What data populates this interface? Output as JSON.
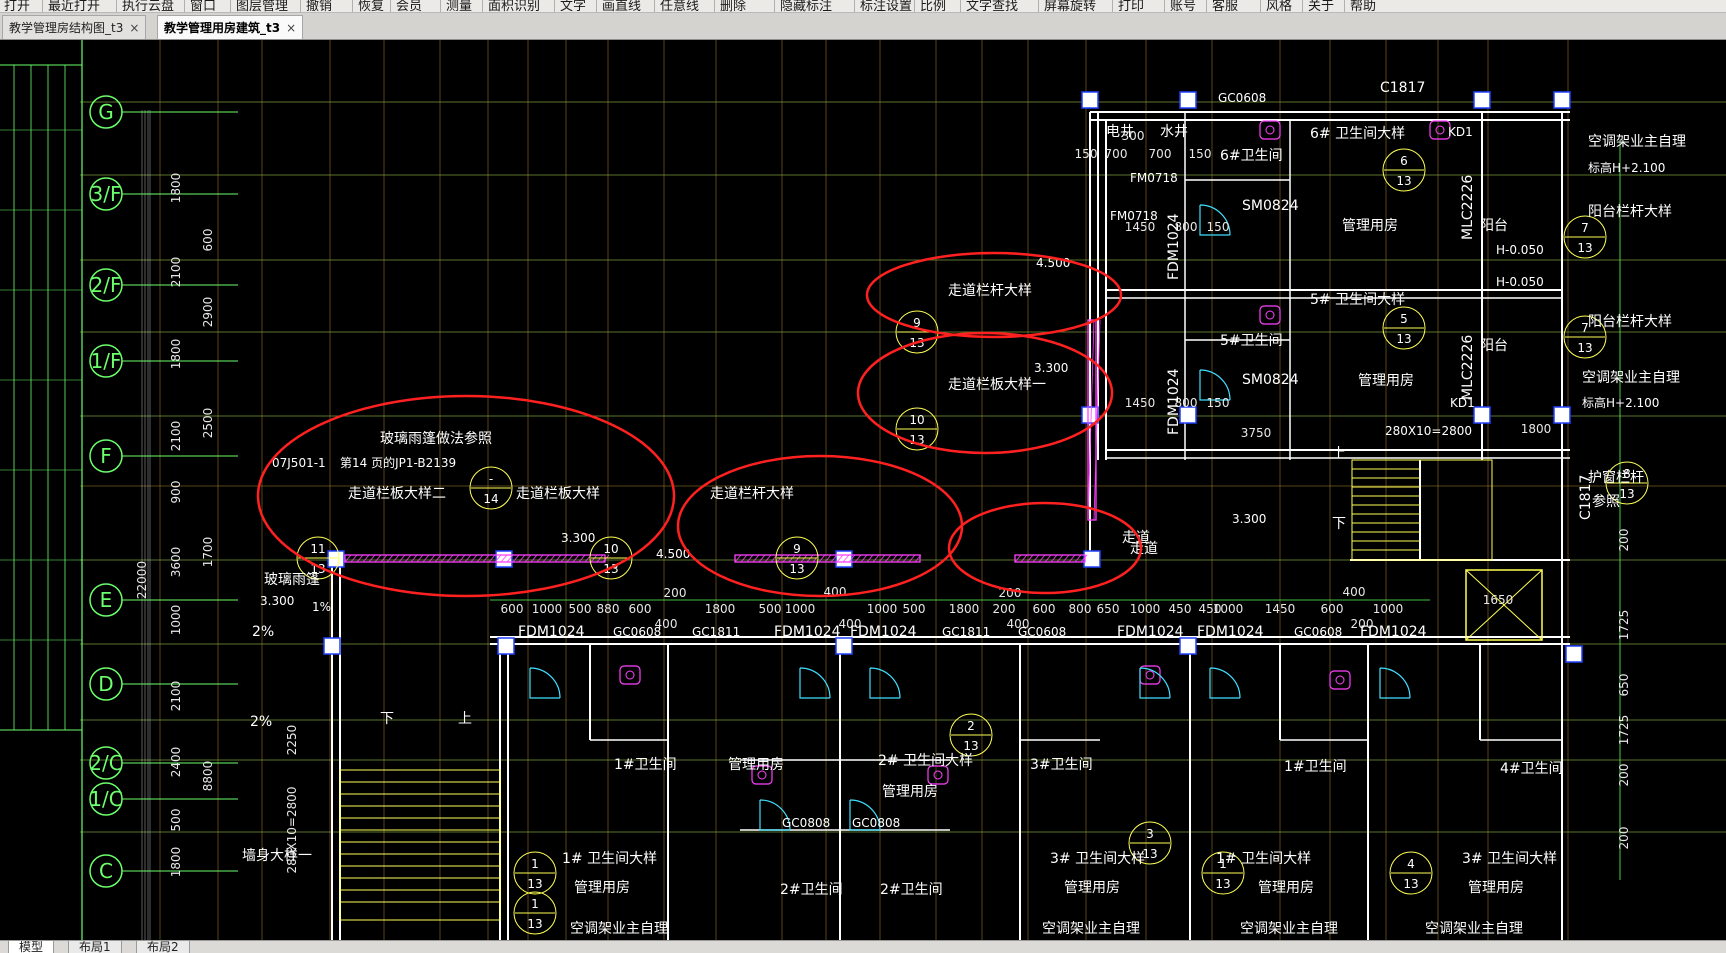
{
  "menu": {
    "items": [
      "打开",
      "最近打开",
      "执行云盘",
      "窗口",
      "图层管理",
      "撤销",
      "恢复",
      "会员",
      "测量",
      "面积识别",
      "文字",
      "画直线",
      "任意线",
      "删除",
      "隐藏标注",
      "标注设置",
      "比例",
      "文字查找",
      "屏幕旋转",
      "打印",
      "账号",
      "客服",
      "风格",
      "关于",
      "帮助"
    ]
  },
  "tabs": [
    {
      "label": "教学管理房结构图_t3",
      "close": "×",
      "active": false
    },
    {
      "label": "教学管理用房建筑_t3",
      "close": "×",
      "active": true
    }
  ],
  "layout_tabs": [
    "模型",
    "布局1",
    "布局2"
  ],
  "axes": {
    "rows": [
      "G",
      "3/F",
      "2/F",
      "1/F",
      "F",
      "E",
      "D",
      "2/C",
      "1/C",
      "C"
    ]
  },
  "left_dims": [
    "1800",
    "2100",
    "1800",
    "2100",
    "900",
    "3600",
    "1000",
    "2100",
    "2400",
    "500",
    "1800",
    "22000",
    "600",
    "2900",
    "2500",
    "1700",
    "8800",
    "2250",
    "280X10=2800"
  ],
  "rooms": {
    "rooms_top": [
      "电井",
      "水井",
      "6#卫生间",
      "6# 卫生间大样",
      "管理用房",
      "阳台",
      "5#卫生间",
      "5# 卫生间大样",
      "管理用房",
      "阳台",
      "走道"
    ],
    "rooms_bottom": [
      "1#卫生间",
      "管理用房",
      "2# 卫生间大样",
      "管理用房",
      "3#卫生间",
      "1#卫生间",
      "4#卫生间",
      "2#卫生间",
      "2#卫生间",
      "1# 卫生间大样",
      "3# 卫生间大样",
      "1# 卫生间大样",
      "3# 卫生间大样",
      "管理用房",
      "管理用房",
      "管理用房",
      "管理用房"
    ],
    "ac_notes": [
      "空调架业主自理",
      "空调架业主自理",
      "空调架业主自理",
      "空调架业主自理",
      "空调架业主自理",
      "空调架业主自理"
    ]
  },
  "labels": {
    "c1817_top": "C1817",
    "gc0608_top": "GC0608",
    "kd1": "KD1",
    "kd1b": "KD1",
    "ac_top": "空调架业主自理",
    "ac_top_h": "标高H+2.100",
    "ac_mid": "空调架业主自理",
    "ac_mid_h": "标高H+2.100",
    "balcony1": "阳台栏杆大样",
    "balcony2": "阳台栏杆大样",
    "window_guard": "护窗栏杆",
    "window_ref": "参照",
    "mlc1": "MLC2226",
    "mlc2": "MLC2226",
    "fdm_a": "FDM1024",
    "fdm_b": "FDM1024",
    "sm1": "SM0824",
    "sm2": "SM0824",
    "fm0718a": "FM0718",
    "fm0718b": "FM0718",
    "h1": "H-0.050",
    "h2": "H-0.050",
    "e1": "4.500",
    "e2": "3.300",
    "e3": "3.300",
    "e4": "3.300",
    "e5": "4.500",
    "e6": "3.300",
    "stairs": "280X10=2800",
    "c1817_side": "C1817",
    "glass": "玻璃雨篷做法参照",
    "glass_ref": "07J501-1",
    "glass_page": "第14 页的JP1-B2139",
    "glass_canopy": "玻璃雨篷",
    "rail1": "走道栏杆大样",
    "rail_slab1": "走道栏板大样一",
    "rail_slab2": "走道栏板大样二",
    "rail_slab3": "走道栏板大样",
    "rail2": "走道栏杆大样",
    "corridor": "走道",
    "bottom_left": "墙身大样一",
    "slope": "2%",
    "slope2": "1%",
    "gc1811a": "GC1811",
    "gc1811b": "GC1811",
    "gc0608a": "GC0608",
    "gc0608b": "GC0608",
    "gc0608c": "GC0608",
    "gc0808a": "GC0808",
    "gc0808b": "GC0808",
    "up": "上",
    "down": "下"
  },
  "detail_refs": [
    {
      "num": "9",
      "sheet": "13"
    },
    {
      "num": "10",
      "sheet": "13"
    },
    {
      "num": "11",
      "sheet": "13"
    },
    {
      "num": "10",
      "sheet": "13"
    },
    {
      "num": "9",
      "sheet": "13"
    },
    {
      "num": "6",
      "sheet": "13"
    },
    {
      "num": "5",
      "sheet": "13"
    },
    {
      "num": "7",
      "sheet": "13"
    },
    {
      "num": "7",
      "sheet": "13"
    },
    {
      "num": "8",
      "sheet": "13"
    },
    {
      "num": "-",
      "sheet": "14"
    },
    {
      "num": "1",
      "sheet": "13"
    },
    {
      "num": "2",
      "sheet": "13"
    },
    {
      "num": "3",
      "sheet": "13"
    },
    {
      "num": "1",
      "sheet": "13"
    },
    {
      "num": "4",
      "sheet": "13"
    },
    {
      "num": "1",
      "sheet": "13"
    }
  ],
  "colors": {
    "axis": "#6bff6b",
    "grid": "#9e7a2e",
    "wall": "#ffffff",
    "annot": "#ff2020",
    "hatch": "#ff40ff",
    "dim": "#55ff55",
    "yellow": "#ffff55",
    "cyan": "#40e0ff"
  }
}
